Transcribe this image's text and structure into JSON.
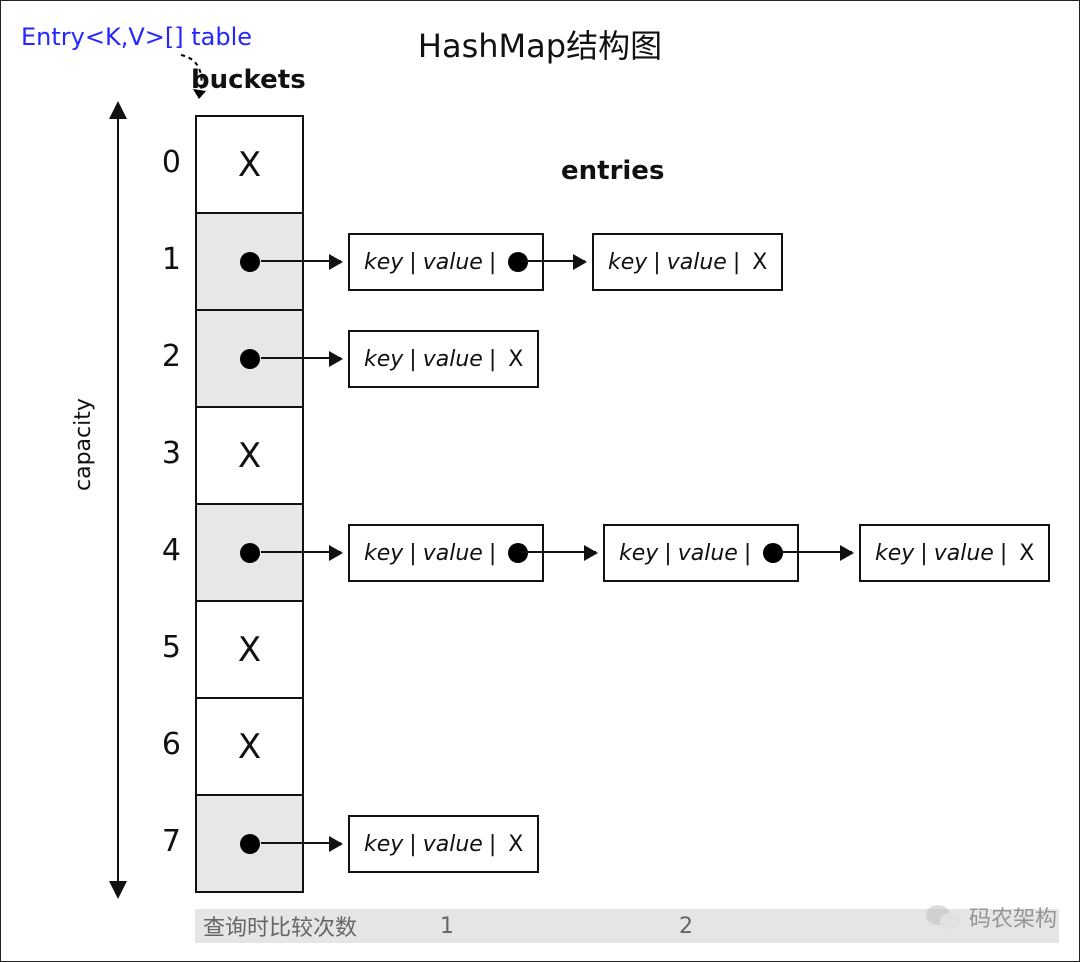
{
  "title": "HashMap结构图",
  "label_top_left": "Entry<K,V>[] table",
  "buckets_label": "buckets",
  "entries_label": "entries",
  "capacity_label": "capacity",
  "entry_text": {
    "key": "key",
    "value": "value",
    "empty": "X"
  },
  "indices": [
    "0",
    "1",
    "2",
    "3",
    "4",
    "5",
    "6",
    "7"
  ],
  "buckets": [
    {
      "index": "0",
      "has_chain": false,
      "chain_len": 0
    },
    {
      "index": "1",
      "has_chain": true,
      "chain_len": 2
    },
    {
      "index": "2",
      "has_chain": true,
      "chain_len": 1
    },
    {
      "index": "3",
      "has_chain": false,
      "chain_len": 0
    },
    {
      "index": "4",
      "has_chain": true,
      "chain_len": 3
    },
    {
      "index": "5",
      "has_chain": false,
      "chain_len": 0
    },
    {
      "index": "6",
      "has_chain": false,
      "chain_len": 0
    },
    {
      "index": "7",
      "has_chain": true,
      "chain_len": 1
    }
  ],
  "footer": {
    "label": "查询时比较次数",
    "col1": "1",
    "col2": "2"
  },
  "watermark": "码农架构"
}
